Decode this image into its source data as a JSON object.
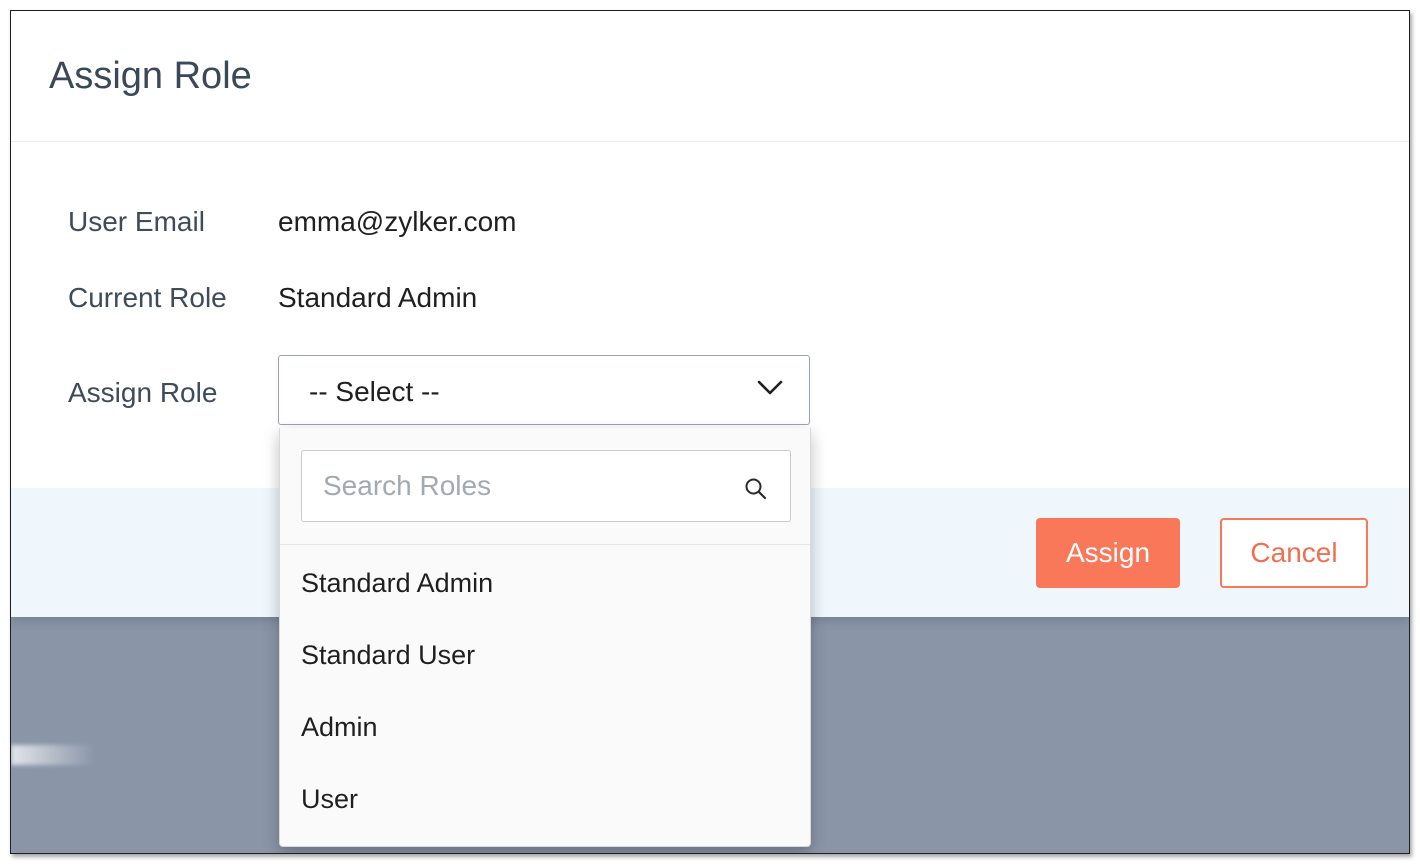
{
  "dialog": {
    "title": "Assign Role"
  },
  "fields": {
    "user_email_label": "User Email",
    "user_email_value": "emma@zylker.com",
    "current_role_label": "Current Role",
    "current_role_value": "Standard Admin",
    "assign_role_label": "Assign Role"
  },
  "role_select": {
    "selected": "-- Select --",
    "icon": "chevron-down-icon",
    "search_placeholder": "Search Roles",
    "search_icon": "search-icon",
    "options": [
      {
        "label": "Standard Admin"
      },
      {
        "label": "Standard User"
      },
      {
        "label": "Admin"
      },
      {
        "label": "User"
      }
    ]
  },
  "footer": {
    "assign_label": "Assign",
    "cancel_label": "Cancel"
  },
  "colors": {
    "accent": "#f97859",
    "footer_bg": "#eff7fc",
    "backdrop": "#8a96a8",
    "title_text": "#3b4858"
  }
}
